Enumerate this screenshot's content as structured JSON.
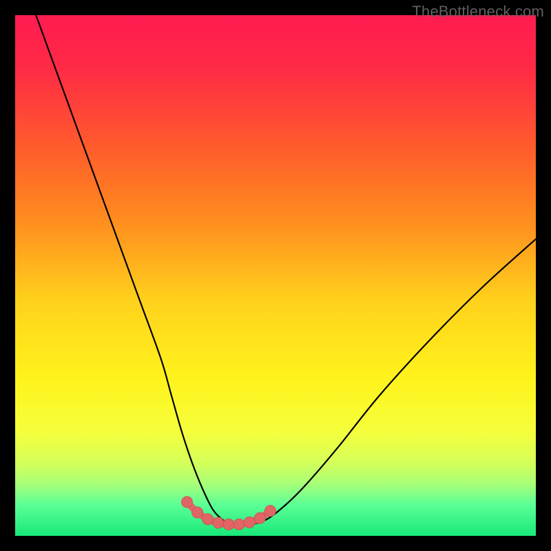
{
  "watermark": "TheBottleneck.com",
  "colors": {
    "gradient_stops": [
      {
        "offset": 0.0,
        "color": "#ff1c50"
      },
      {
        "offset": 0.1,
        "color": "#ff2a46"
      },
      {
        "offset": 0.25,
        "color": "#ff5a2c"
      },
      {
        "offset": 0.4,
        "color": "#ff8f1e"
      },
      {
        "offset": 0.55,
        "color": "#ffd21c"
      },
      {
        "offset": 0.7,
        "color": "#fff31c"
      },
      {
        "offset": 0.8,
        "color": "#f5ff3c"
      },
      {
        "offset": 0.86,
        "color": "#d4ff5a"
      },
      {
        "offset": 0.9,
        "color": "#a8ff78"
      },
      {
        "offset": 0.94,
        "color": "#5cff96"
      },
      {
        "offset": 1.0,
        "color": "#18e87a"
      }
    ],
    "curve_stroke": "#000000",
    "marker_fill": "#e06666",
    "marker_stroke": "#cc5555"
  },
  "chart_data": {
    "type": "line",
    "title": "",
    "xlabel": "",
    "ylabel": "",
    "xlim": [
      0,
      100
    ],
    "ylim": [
      0,
      100
    ],
    "series": [
      {
        "name": "bottleneck-curve",
        "x": [
          4,
          8,
          12,
          16,
          20,
          24,
          28,
          30,
          32,
          34,
          36,
          38,
          40,
          42,
          44,
          48,
          52,
          56,
          62,
          70,
          80,
          90,
          100
        ],
        "y": [
          100,
          89,
          78,
          67,
          56,
          45,
          34,
          27,
          20,
          14,
          9,
          5,
          3,
          2,
          2,
          3,
          6,
          10,
          17,
          27,
          38,
          48,
          57
        ]
      }
    ],
    "markers": {
      "name": "highlighted-range",
      "x": [
        33,
        35,
        37,
        39,
        41,
        43,
        45,
        47,
        49
      ],
      "y": [
        6.5,
        4.5,
        3.2,
        2.5,
        2.2,
        2.2,
        2.6,
        3.4,
        4.8
      ]
    }
  }
}
